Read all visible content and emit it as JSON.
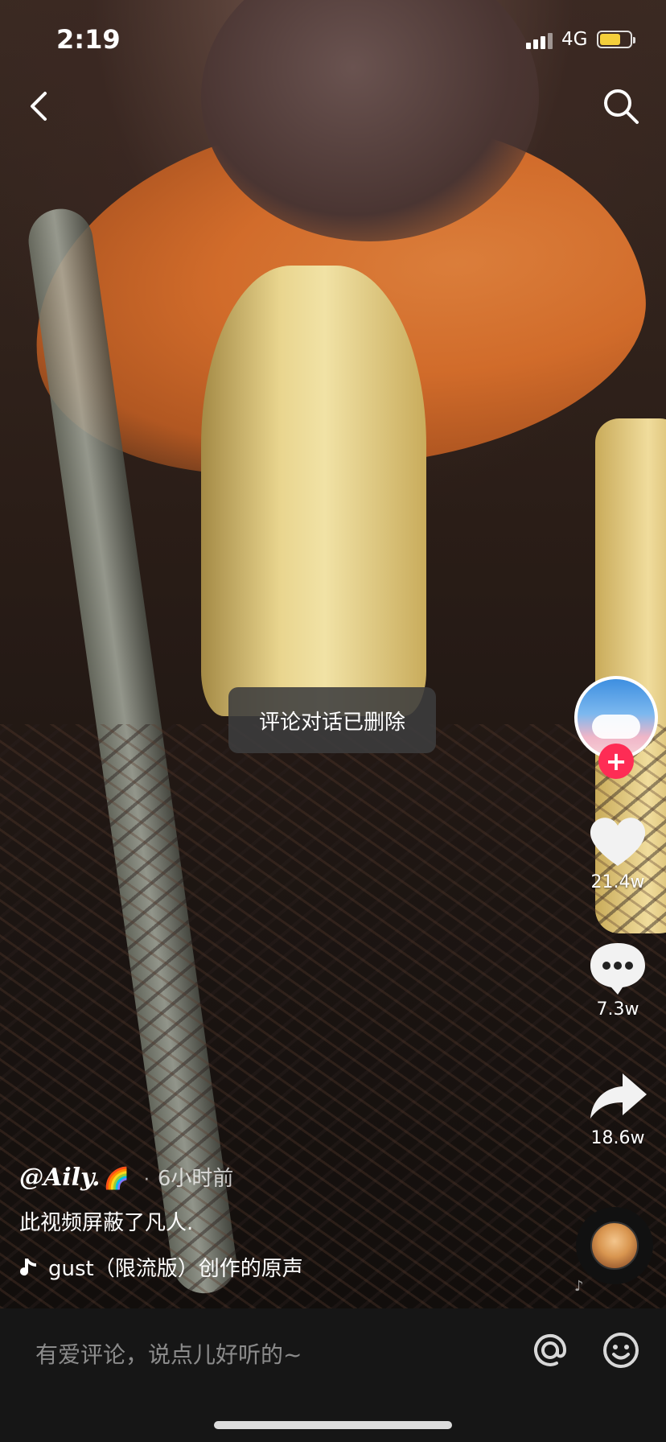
{
  "status_bar": {
    "time": "2:19",
    "network": "4G",
    "battery_level": 0.7,
    "battery_color": "#f4cf3b"
  },
  "nav": {
    "back_icon": "chevron-left-icon",
    "search_icon": "search-icon"
  },
  "toast": {
    "text": "评论对话已删除"
  },
  "rail": {
    "follow_label": "+",
    "like_count": "21.4w",
    "comment_count": "7.3w",
    "share_count": "18.6w",
    "accent_color": "#fe2c55"
  },
  "info": {
    "author": "@Aily.",
    "author_emoji": "🌈",
    "separator": "·",
    "time_ago": "6小时前",
    "caption": "此视频屏蔽了凡人.",
    "music": "gust（限流版）创作的原声"
  },
  "comment_bar": {
    "placeholder": "有爱评论，说点儿好听的~"
  }
}
